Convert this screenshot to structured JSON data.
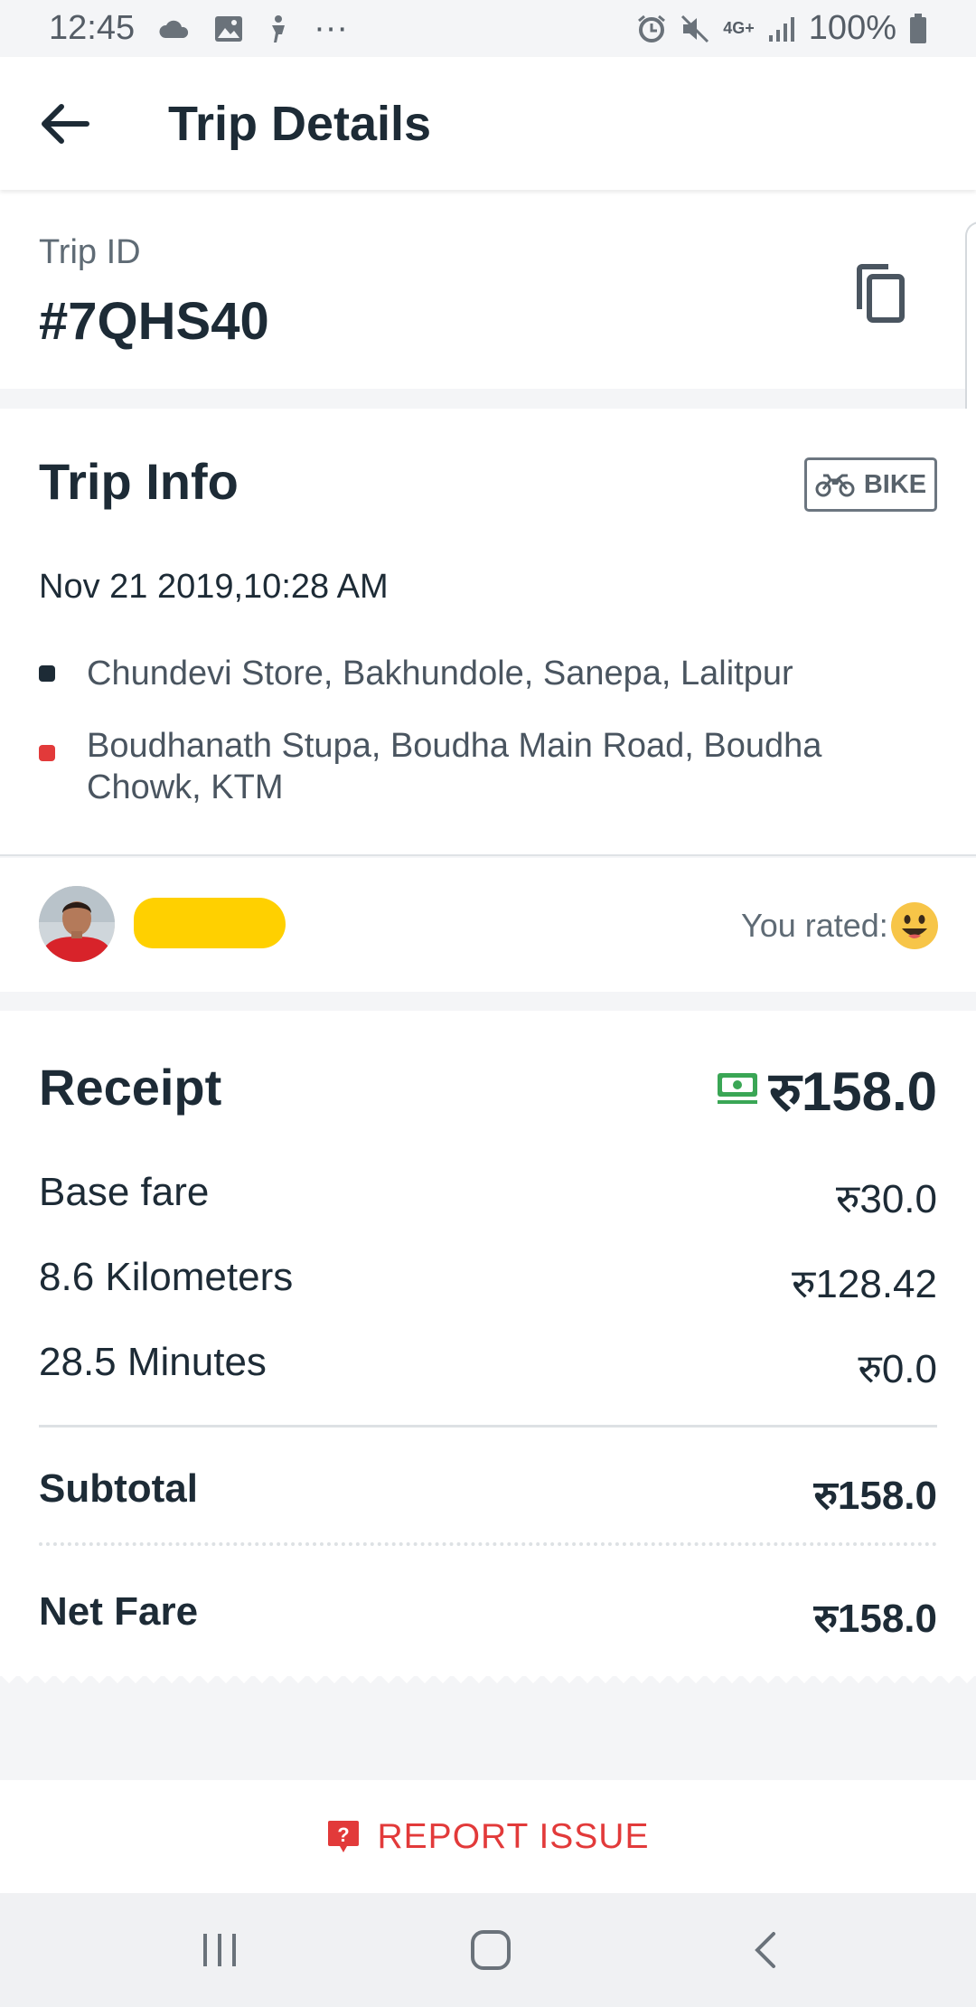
{
  "status_bar": {
    "time": "12:45",
    "battery": "100%",
    "network": "4G+",
    "more": "···"
  },
  "app_bar": {
    "title": "Trip Details"
  },
  "trip_id": {
    "label": "Trip ID",
    "value": "#7QHS40"
  },
  "trip_info": {
    "title": "Trip Info",
    "vehicle": "BIKE",
    "datetime": "Nov 21 2019,10:28 AM",
    "pickup": "Chundevi Store, Bakhundole, Sanepa, Lalitpur",
    "dropoff": "Boudhanath Stupa, Boudha Main Road, Boudha Chowk, KTM",
    "pickup_color": "#1d2b36",
    "dropoff_color": "#e23a3a"
  },
  "rating": {
    "label": "You rated:"
  },
  "receipt": {
    "title": "Receipt",
    "total": "रु158.0",
    "lines": [
      {
        "label": "Base fare",
        "amount": "रु30.0"
      },
      {
        "label": "8.6 Kilometers",
        "amount": "रु128.42"
      },
      {
        "label": "28.5 Minutes",
        "amount": "रु0.0"
      }
    ],
    "subtotal_label": "Subtotal",
    "subtotal_amount": "रु158.0",
    "net_label": "Net Fare",
    "net_amount": "रु158.0"
  },
  "report": {
    "label": "REPORT ISSUE",
    "color": "#e23a3a"
  },
  "colors": {
    "text_primary": "#1d2b36",
    "accent_red": "#e23a3a",
    "cash_green": "#3aa655",
    "background": "#f4f5f7"
  }
}
